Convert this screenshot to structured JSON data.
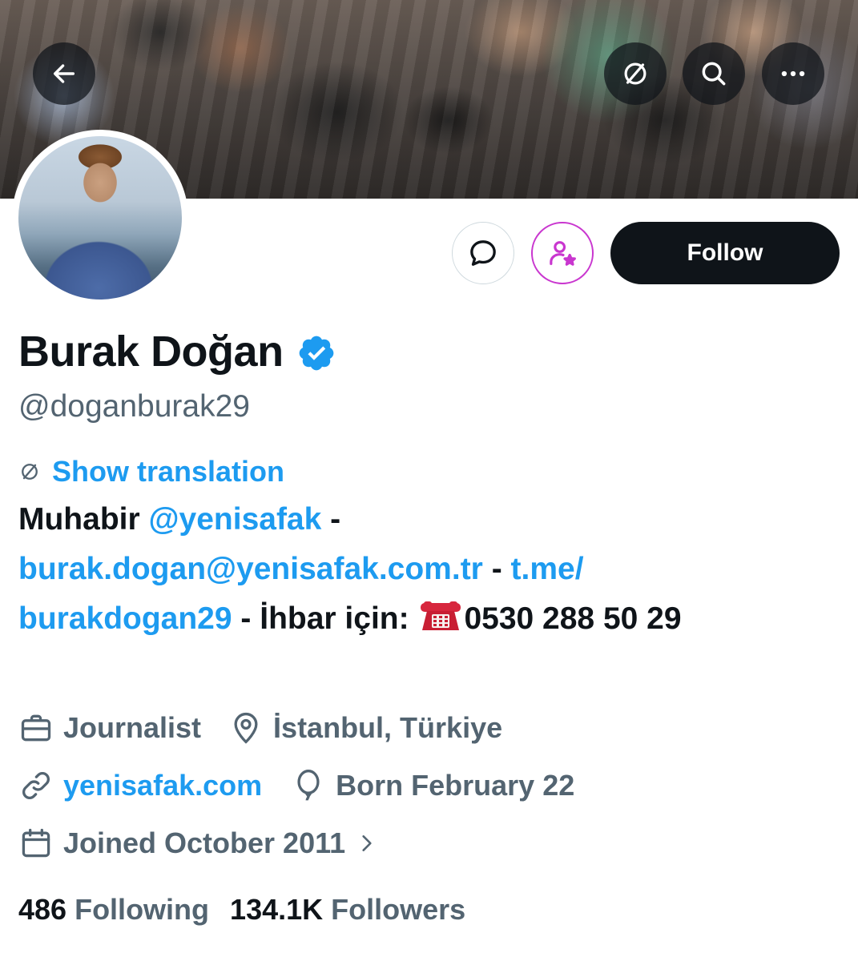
{
  "profile": {
    "name": "Burak Doğan",
    "handle": "@doganburak29",
    "verified_color": "#1d9bf0"
  },
  "header": {
    "back_icon": "arrow-left-icon",
    "translate_icon": "translate-icon",
    "search_icon": "search-icon",
    "more_icon": "more-horizontal-icon"
  },
  "actions": {
    "message_icon": "message-bubble-icon",
    "subscribe_icon": "person-star-icon",
    "follow_label": "Follow"
  },
  "translation": {
    "label": "Show translation"
  },
  "bio": {
    "part1": "Muhabir ",
    "mention": "@yenisafak",
    "sep1": " -",
    "email": "burak.dogan@yenisafak.com.tr",
    "sep2": " - ",
    "link_part1": "t.me/",
    "link_part2": "burakdogan29",
    "part2": " - İhbar için: ",
    "phone_icon": "telephone-icon",
    "phone_number": "0530 288 50 29"
  },
  "meta": {
    "category": "Journalist",
    "location": "İstanbul, Türkiye",
    "website": "yenisafak.com",
    "birthday": "Born February 22",
    "joined": "Joined October 2011"
  },
  "stats": {
    "following_count": "486",
    "following_label": "Following",
    "followers_count": "134.1K",
    "followers_label": "Followers"
  },
  "colors": {
    "accent": "#1d9bf0",
    "text_primary": "#0f1419",
    "text_secondary": "#536471",
    "subscribe_accent": "#c936cf"
  }
}
